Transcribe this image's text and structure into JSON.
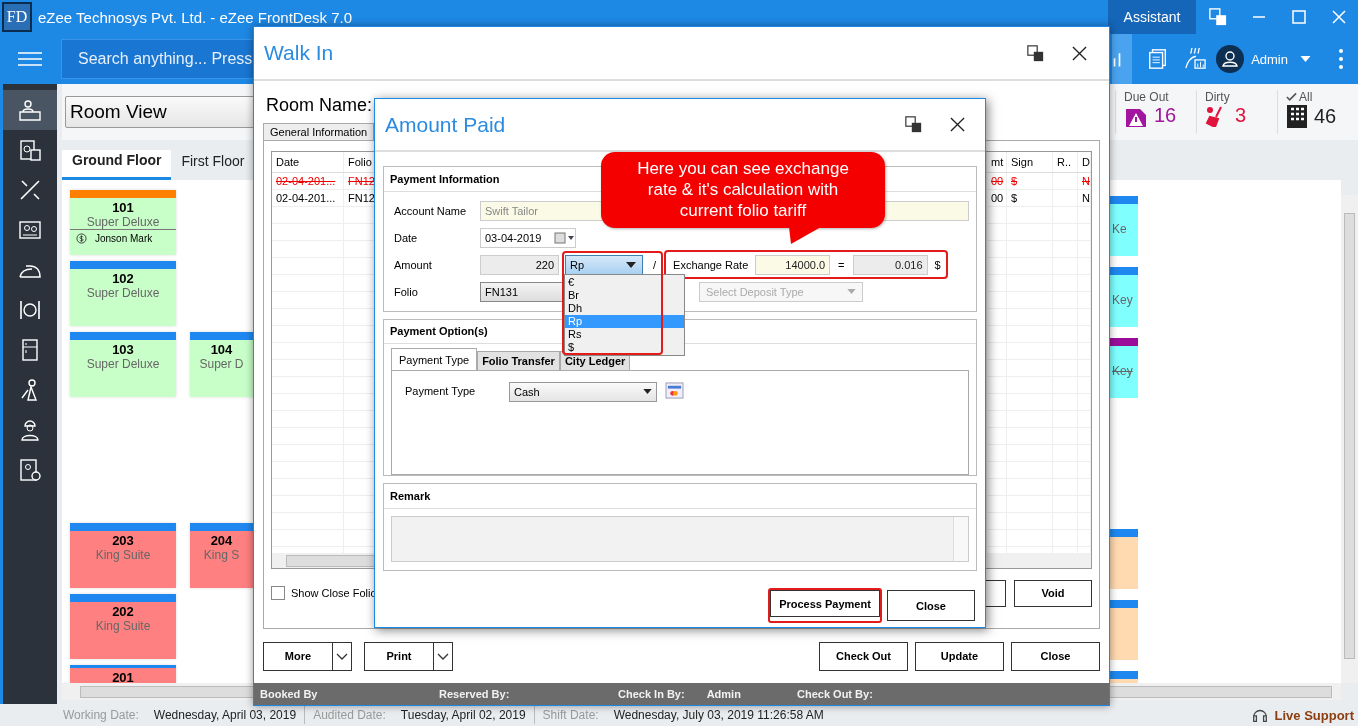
{
  "app": {
    "logo": "FD",
    "title": "eZee Technosys Pvt. Ltd. - eZee FrontDesk 7.0",
    "assistant": "Assistant",
    "search_placeholder": "Search anything... Press",
    "user": "Admin"
  },
  "sidebar": [
    {
      "kind": "desk",
      "selected": true
    },
    {
      "kind": "calculator",
      "selected": false
    },
    {
      "kind": "tools",
      "selected": false
    },
    {
      "kind": "card",
      "selected": false
    },
    {
      "kind": "iron",
      "selected": false
    },
    {
      "kind": "dining",
      "selected": false
    },
    {
      "kind": "fridge",
      "selected": false
    },
    {
      "kind": "housekeeper",
      "selected": false
    },
    {
      "kind": "worker",
      "selected": false
    },
    {
      "kind": "invoice",
      "selected": false
    }
  ],
  "view_selector": "Room View",
  "stats": [
    {
      "kind": "due_out",
      "label": "Due Out",
      "value": "16"
    },
    {
      "kind": "dirty",
      "label": "Dirty",
      "value": "3"
    },
    {
      "kind": "all",
      "label": "All",
      "value": "46"
    }
  ],
  "floor_tabs": [
    {
      "label": "Ground Floor",
      "selected": true
    },
    {
      "label": "First Floor",
      "selected": false
    }
  ],
  "room_groups": [
    {
      "rows": [
        {
          "tiles": [
            {
              "number": "101",
              "type": "Super Deluxe",
              "guest": "Jonson Mark",
              "strip": {
                "color": "#ff8000"
              },
              "color": "#c8ffc8"
            }
          ],
          "edge": {
            "text": "Ke",
            "struck": false,
            "strip": {
              "color": "#1e88f0"
            },
            "color": "#80ffff"
          }
        },
        {
          "tiles": [
            {
              "number": "102",
              "type": "Super Deluxe",
              "strip": {
                "color": "#1e88f0"
              },
              "color": "#c8ffc8"
            }
          ],
          "edge": {
            "text": "Key",
            "struck": false,
            "strip": {
              "color": "#1e88f0"
            },
            "color": "#80ffff"
          }
        },
        {
          "tiles": [
            {
              "number": "103",
              "type": "Super Deluxe",
              "strip": {
                "color": "#1e88f0"
              },
              "color": "#c8ffc8"
            },
            {
              "number": "104",
              "type": "Super D",
              "strip": {
                "color": "#1e88f0"
              },
              "color": "#c8ffc8"
            }
          ],
          "edge": {
            "text": "Key",
            "struck": true,
            "strip": {
              "color": "#9a0d9a"
            },
            "color": "#80ffff"
          }
        }
      ]
    },
    {
      "rows": [
        {
          "tiles": [
            {
              "number": "203",
              "type": "King Suite",
              "strip": {
                "color": "#1e88f0"
              },
              "color": "#ff8080"
            },
            {
              "number": "204",
              "type": "King S",
              "strip": {
                "color": "#1e88f0"
              },
              "color": "#ff8080"
            }
          ],
          "edge": {
            "strip": {
              "color": "#1e88f0"
            },
            "color": "#ffd9b0"
          }
        },
        {
          "tiles": [
            {
              "number": "202",
              "type": "King Suite",
              "strip": {
                "color": "#1e88f0"
              },
              "color": "#ff8080"
            }
          ],
          "edge": {
            "strip": {
              "color": "#1e88f0"
            },
            "color": "#ffd9b0"
          }
        },
        {
          "tiles": [
            {
              "number": "201",
              "strip": {
                "color": "#1e88f0"
              },
              "color": "#ff8080"
            }
          ],
          "edge": {
            "strip": {
              "color": "#1e88f0"
            },
            "color": "#ffd9b0"
          }
        }
      ]
    }
  ],
  "walk_in": {
    "title": "Walk In",
    "room_name_label": "Room Name:",
    "tab": "General Information",
    "grid": {
      "columns": [
        "Date",
        "Folio",
        "mt",
        "Sign",
        "R..",
        "D"
      ],
      "rows": [
        {
          "voided": true,
          "cells": [
            "02-04-201...",
            "FN12",
            "00",
            "$",
            null,
            "N"
          ]
        },
        {
          "voided": false,
          "cells": [
            "02-04-201...",
            "FN12",
            "00",
            "$",
            null,
            "N"
          ]
        }
      ]
    },
    "show_close_folio": {
      "label": "Show Close Folic",
      "checked": false
    },
    "void": "Void",
    "split_buttons": [
      "More",
      "Print"
    ],
    "buttons": [
      "Check Out",
      "Update",
      "Close"
    ],
    "footer": [
      {
        "label": "Booked By"
      },
      {
        "label": "Reserved By:"
      },
      {
        "label": "Check In By:",
        "value": "Admin"
      },
      {
        "label": "Check Out By:"
      }
    ]
  },
  "amount_paid": {
    "title": "Amount Paid",
    "payment_info": {
      "heading": "Payment Information",
      "account_name": {
        "label": "Account Name",
        "value": "Swift Tailor"
      },
      "date": {
        "label": "Date",
        "value": "03-04-2019"
      },
      "amount": {
        "label": "Amount",
        "value": "220"
      },
      "currency": {
        "value": "Rp",
        "expanded": true,
        "highlighted": true,
        "options": [
          {
            "label": "€",
            "selected": false
          },
          {
            "label": "Br",
            "selected": false
          },
          {
            "label": "Dh",
            "selected": false
          },
          {
            "label": "Rp",
            "selected": true
          },
          {
            "label": "Rs",
            "selected": false
          },
          {
            "label": "$",
            "selected": false
          }
        ]
      },
      "separator": "/",
      "exchange": {
        "label": "Exchange Rate",
        "rate": "14000.0",
        "equals": "=",
        "converted": "0.016",
        "symbol": "$",
        "highlighted": true
      },
      "folio": {
        "label": "Folio",
        "value": "FN131"
      },
      "deposit_type": {
        "placeholder": "Select Deposit Type",
        "disabled": true
      }
    },
    "payment_options": {
      "heading": "Payment Option(s)",
      "tabs": [
        {
          "label": "Payment Type",
          "selected": true
        },
        {
          "label": "Folio Transfer",
          "selected": false
        },
        {
          "label": "City Ledger",
          "selected": false
        }
      ],
      "payment_type": {
        "label": "Payment Type",
        "value": "Cash"
      }
    },
    "remark": {
      "heading": "Remark"
    },
    "buttons": [
      {
        "label": "Process Payment",
        "highlighted": true
      },
      {
        "label": "Close",
        "highlighted": false
      }
    ]
  },
  "callout": {
    "text": "Here you can see exchange rate & it's calculation with current folio tariff"
  },
  "status_bar": [
    {
      "label": "Working Date:",
      "value": "Wednesday, April 03, 2019"
    },
    {
      "label": "Audited Date:",
      "value": "Tuesday, April 02, 2019"
    },
    {
      "label": "Shift Date:",
      "value": "Wednesday, July 03, 2019 11:26:58 AM"
    }
  ],
  "live_support": "Live Support"
}
